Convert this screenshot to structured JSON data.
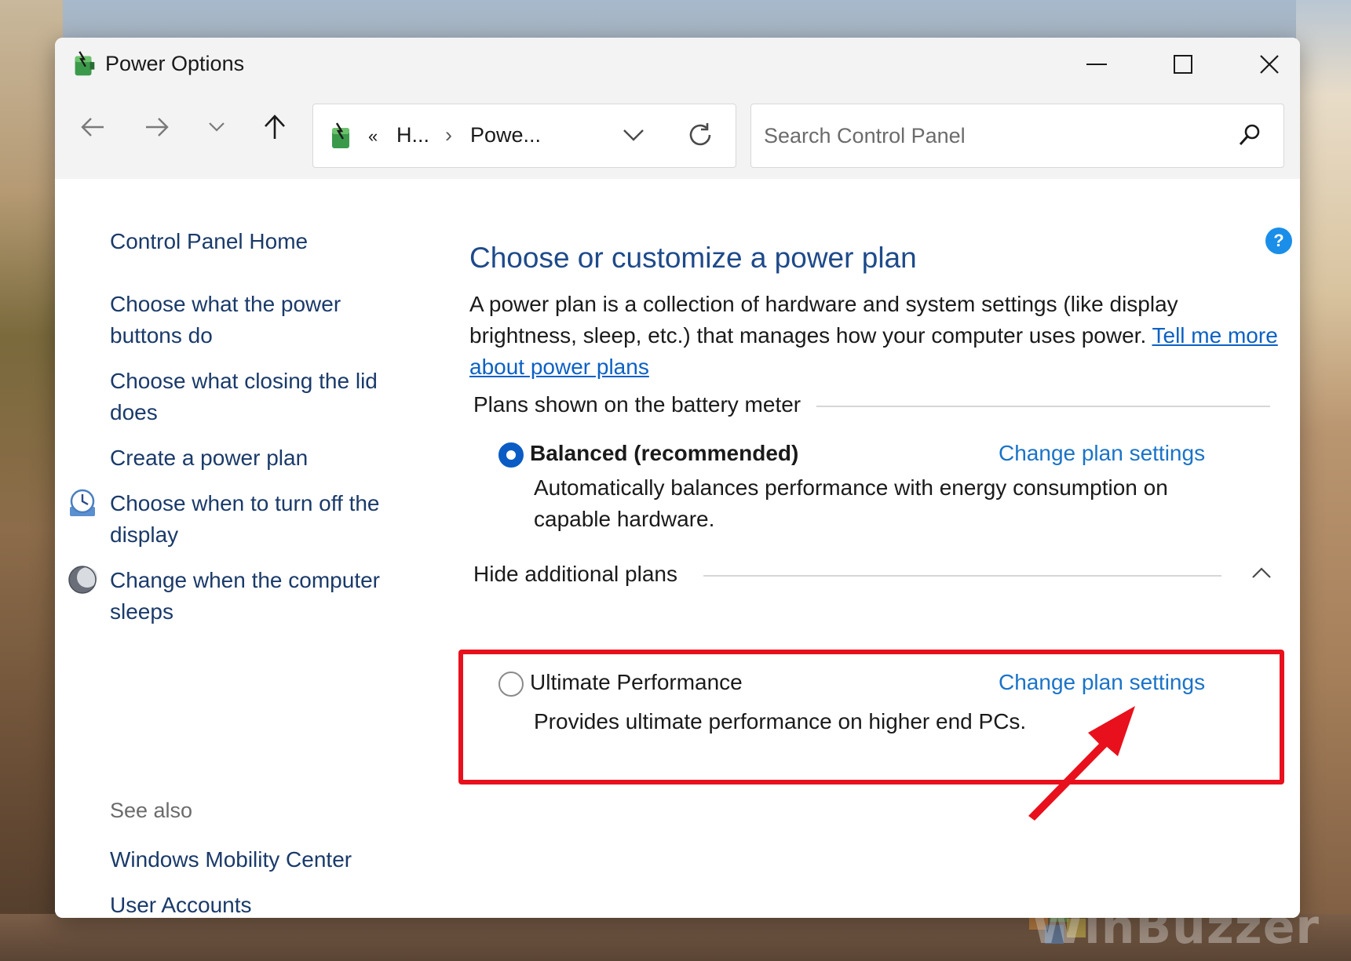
{
  "window": {
    "title": "Power Options"
  },
  "nav": {
    "address_parts": [
      "«",
      "H...",
      "›",
      "Powe..."
    ],
    "search_placeholder": "Search Control Panel"
  },
  "sidebar": {
    "home": "Control Panel Home",
    "links": [
      {
        "label": "Choose what the power buttons do",
        "icon": ""
      },
      {
        "label": "Choose what closing the lid does",
        "icon": ""
      },
      {
        "label": "Create a power plan",
        "icon": ""
      },
      {
        "label": "Choose when to turn off the display",
        "icon": "clock-icon"
      },
      {
        "label": "Change when the computer sleeps",
        "icon": "moon-icon"
      }
    ],
    "see_also": "See also",
    "see_also_links": [
      "Windows Mobility Center",
      "User Accounts"
    ]
  },
  "main": {
    "title": "Choose or customize a power plan",
    "description": "A power plan is a collection of hardware and system settings (like display brightness, sleep, etc.) that manages how your computer uses power.",
    "description_link": "Tell me more about power plans",
    "battery_group": "Plans shown on the battery meter",
    "additional_group": "Hide additional plans",
    "plans": [
      {
        "name": "Balanced (recommended)",
        "selected": true,
        "description": "Automatically balances performance with energy consumption on capable hardware.",
        "link": "Change plan settings"
      },
      {
        "name": "Ultimate Performance",
        "selected": false,
        "description": "Provides ultimate performance on higher end PCs.",
        "link": "Change plan settings"
      }
    ]
  },
  "watermark": "WinBuzzer",
  "colors": {
    "accent": "#0a5cc4",
    "link": "#1a73c8",
    "title": "#1e4a8a",
    "highlight": "#e8101c"
  }
}
